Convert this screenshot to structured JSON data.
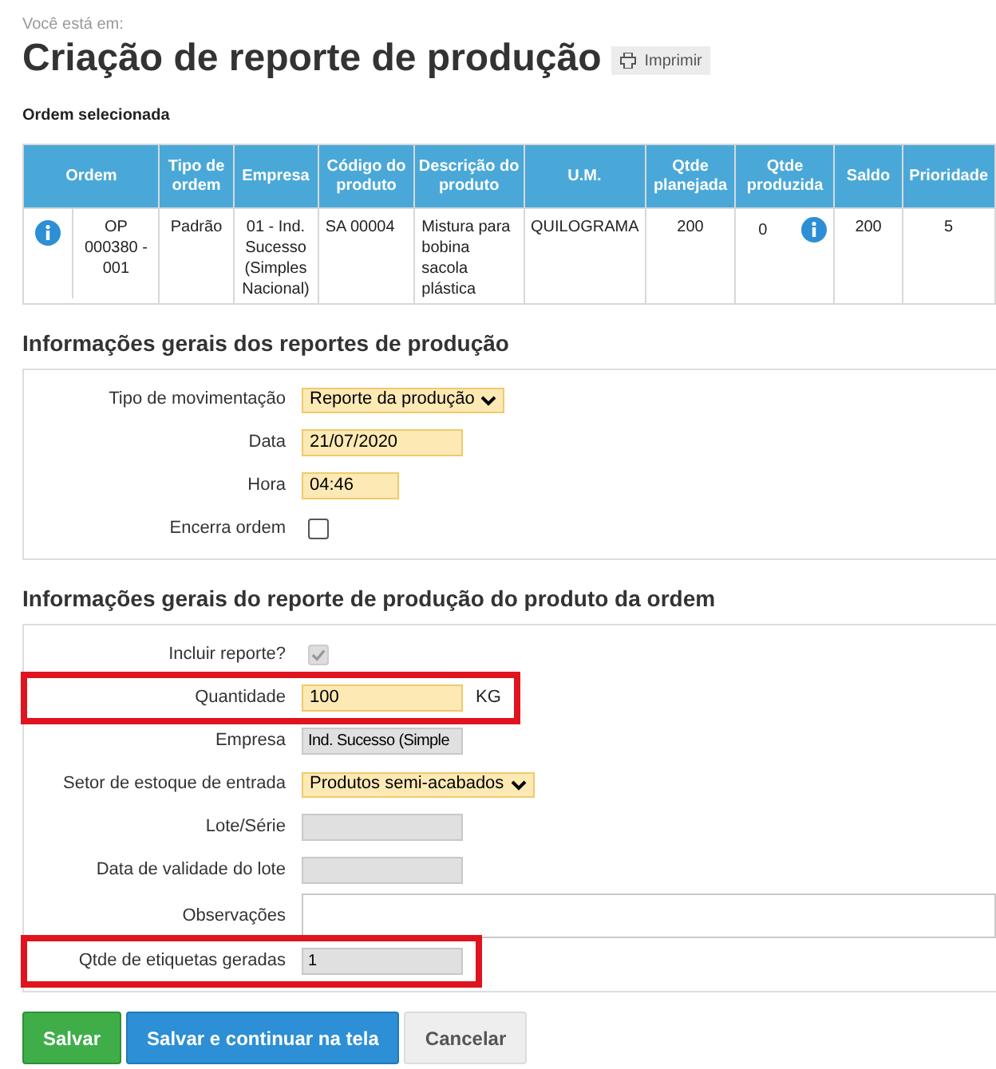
{
  "breadcrumb": "Você está em:",
  "title": "Criação de reporte de produção",
  "print_button": "Imprimir",
  "order_section": {
    "label": "Ordem selecionada",
    "columns": [
      "Ordem",
      "Tipo de ordem",
      "Empresa",
      "Código do produto",
      "Descrição do produto",
      "U.M.",
      "Qtde planejada",
      "Qtde produzida",
      "Saldo",
      "Prioridade"
    ],
    "rows": [
      {
        "cells": [
          {
            "kind": "info_text",
            "text": "OP 000380 - 001"
          },
          {
            "kind": "text",
            "text": "Padrão"
          },
          {
            "kind": "text",
            "text": "01 - Ind. Sucesso (Simples Nacional)"
          },
          {
            "kind": "text",
            "text": "SA 00004"
          },
          {
            "kind": "text",
            "text": "Mistura para bobina sacola plástica"
          },
          {
            "kind": "text",
            "text": "QUILOGRAMA"
          },
          {
            "kind": "text",
            "text": "200"
          },
          {
            "kind": "text_info",
            "text": "0"
          },
          {
            "kind": "text",
            "text": "200"
          },
          {
            "kind": "text",
            "text": "5"
          }
        ]
      }
    ]
  },
  "sections": [
    {
      "title": "Informações gerais dos reportes de produção",
      "fields": [
        {
          "kind": "select",
          "label": "Tipo de movimentação",
          "value": "Reporte da produção",
          "highlighted": false
        },
        {
          "kind": "input",
          "label": "Data",
          "value": "21/07/2020",
          "highlighted": false
        },
        {
          "kind": "short_input",
          "label": "Hora",
          "value": "04:46",
          "highlighted": false
        },
        {
          "kind": "checkbox",
          "label": "Encerra ordem",
          "checked": false,
          "disabled": false,
          "highlighted": false
        }
      ]
    },
    {
      "title": "Informações gerais do reporte de produção do produto da ordem",
      "fields": [
        {
          "kind": "checkbox",
          "label": "Incluir reporte?",
          "checked": true,
          "disabled": true,
          "highlighted": false
        },
        {
          "kind": "input",
          "label": "Quantidade",
          "value": "100",
          "unit": "KG",
          "highlighted": true
        },
        {
          "kind": "readonly",
          "label": "Empresa",
          "value": "Ind. Sucesso (Simple",
          "highlighted": false
        },
        {
          "kind": "select",
          "label": "Setor de estoque de entrada",
          "value": "Produtos semi-acabados",
          "highlighted": false
        },
        {
          "kind": "readonly",
          "label": "Lote/Série",
          "highlighted": false
        },
        {
          "kind": "readonly",
          "label": "Data de validade do lote",
          "highlighted": false
        },
        {
          "kind": "textarea",
          "label": "Observações",
          "highlighted": false
        },
        {
          "kind": "readonly",
          "label": "Qtde de etiquetas geradas",
          "value": "1",
          "highlighted": true
        }
      ]
    }
  ],
  "buttons": [
    {
      "label": "Salvar",
      "kind": "success"
    },
    {
      "label": "Salvar e continuar na tela",
      "kind": "primary"
    },
    {
      "label": "Cancelar",
      "kind": "default"
    }
  ]
}
